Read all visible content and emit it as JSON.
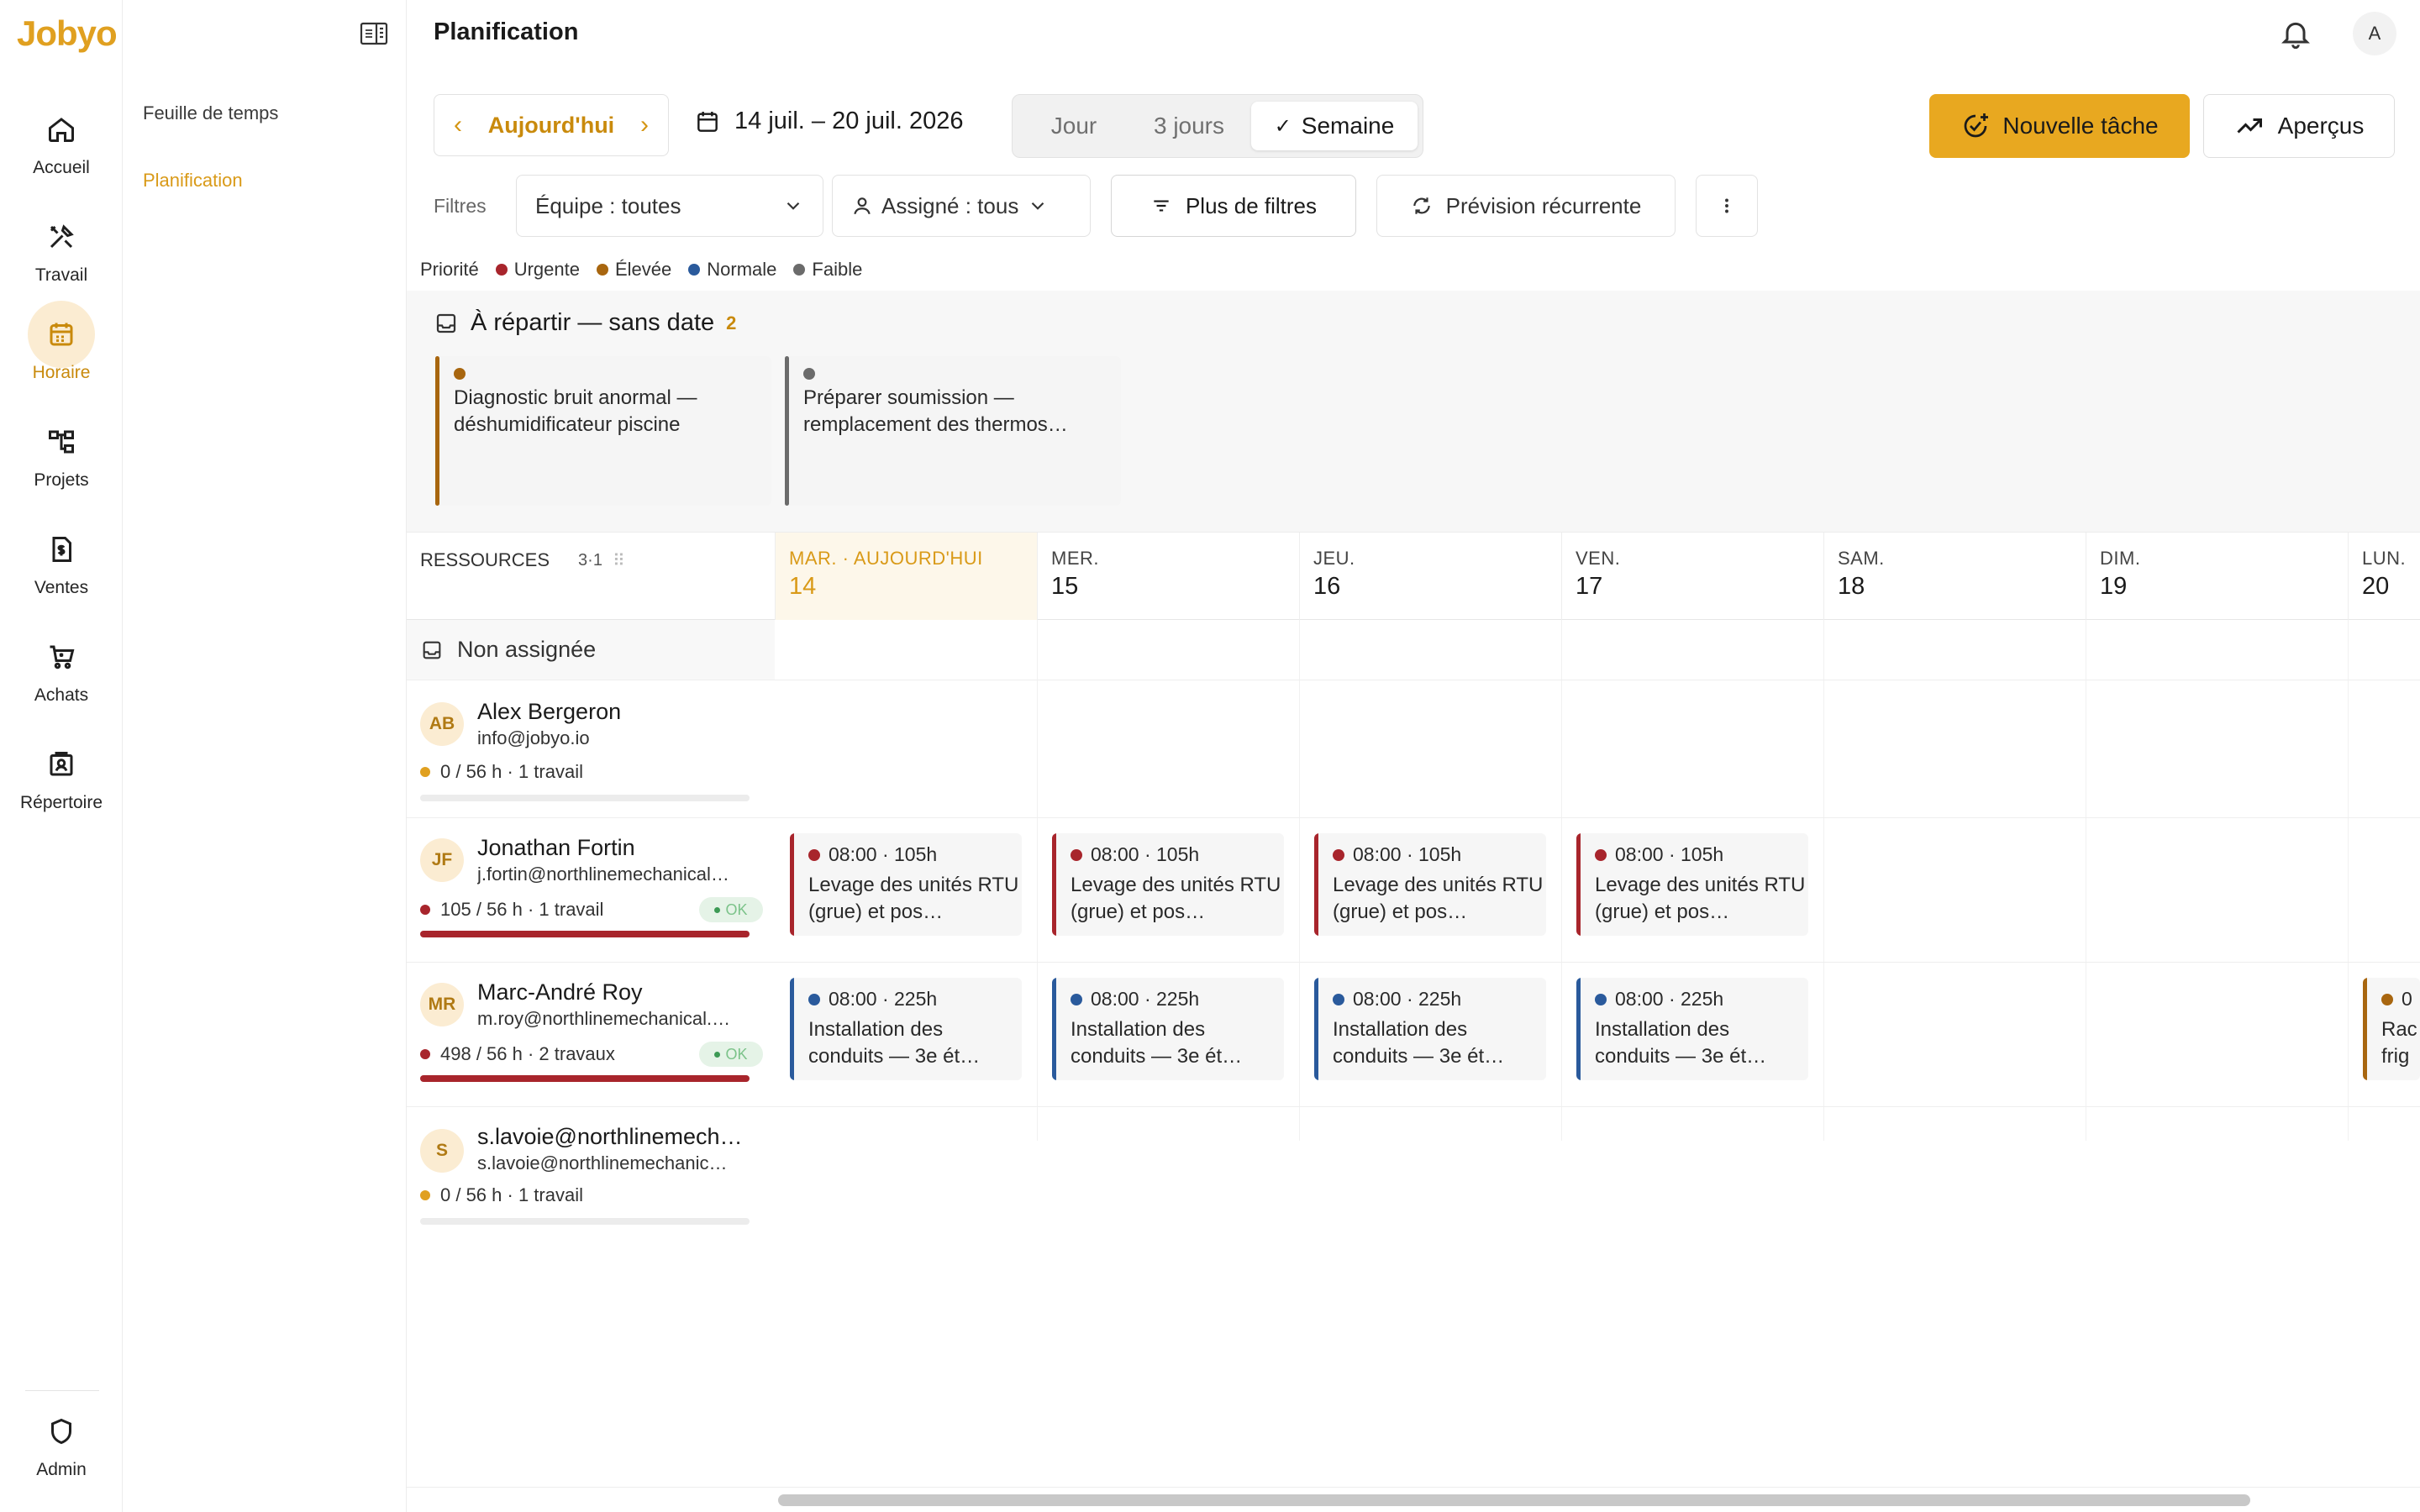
{
  "app": {
    "brand": "Jobyo",
    "user_initial": "A"
  },
  "rail": [
    {
      "label": "Accueil",
      "icon": "home-icon"
    },
    {
      "label": "Travail",
      "icon": "tools-icon"
    },
    {
      "label": "Horaire",
      "icon": "calendar-icon",
      "active": true
    },
    {
      "label": "Projets",
      "icon": "sitemap-icon"
    },
    {
      "label": "Ventes",
      "icon": "invoice-icon"
    },
    {
      "label": "Achats",
      "icon": "cart-icon"
    },
    {
      "label": "Répertoire",
      "icon": "contacts-icon"
    }
  ],
  "rail_bottom": {
    "label": "Admin",
    "icon": "shield-icon"
  },
  "subnav": [
    {
      "label": "Feuille de temps"
    },
    {
      "label": "Planification",
      "active": true
    }
  ],
  "header": {
    "title": "Planification"
  },
  "toolbar": {
    "today_label": "Aujourd'hui",
    "range_label": "14 juil. – 20 juil. 2026",
    "views": [
      "Jour",
      "3 jours",
      "Semaine"
    ],
    "active_view": "Semaine",
    "new_task_label": "Nouvelle tâche",
    "overview_label": "Aperçus"
  },
  "filters": {
    "label": "Filtres",
    "team": "Équipe : toutes",
    "assignee": "Assigné : tous",
    "more": "Plus de filtres",
    "recurring": "Prévision récurrente"
  },
  "priority": {
    "label": "Priorité",
    "items": [
      {
        "label": "Urgente",
        "color": "#a8252c"
      },
      {
        "label": "Élevée",
        "color": "#a8660f"
      },
      {
        "label": "Normale",
        "color": "#2a5a9c"
      },
      {
        "label": "Faible",
        "color": "#6b6b6b"
      }
    ]
  },
  "unassigned_strip": {
    "title": "À répartir — sans date",
    "count": "2",
    "cards": [
      {
        "text": "Diagnostic bruit anormal — déshumidificateur piscine",
        "color": "#a8660f"
      },
      {
        "text": "Préparer soumission — remplacement des thermos…",
        "color": "#6b6b6b"
      }
    ]
  },
  "grid": {
    "resources_label": "RESSOURCES",
    "resources_count": "3·1",
    "days": [
      {
        "name": "MAR. · AUJOURD'HUI",
        "num": "14",
        "today": true
      },
      {
        "name": "MER.",
        "num": "15"
      },
      {
        "name": "JEU.",
        "num": "16"
      },
      {
        "name": "VEN.",
        "num": "17"
      },
      {
        "name": "SAM.",
        "num": "18"
      },
      {
        "name": "DIM.",
        "num": "19"
      },
      {
        "name": "LUN.",
        "num": "20"
      }
    ],
    "unassigned_row_label": "Non assignée",
    "resources": [
      {
        "initials": "AB",
        "name": "Alex Bergeron",
        "email": "info@jobyo.io",
        "load": "0 / 56 h · 1 travail",
        "dot": "#e0a020",
        "overloaded": false,
        "badge": "",
        "load_fraction": 0
      },
      {
        "initials": "JF",
        "name": "Jonathan Fortin",
        "email": "j.fortin@northlinemechanical…",
        "load": "105 / 56 h · 1 travail",
        "dot": "#a8252c",
        "overloaded": true,
        "badge": "OK",
        "load_fraction": 1.88
      },
      {
        "initials": "MR",
        "name": "Marc-André Roy",
        "email": "m.roy@northlinemechanical.…",
        "load": "498 / 56 h · 2 travaux",
        "dot": "#a8252c",
        "overloaded": true,
        "badge": "OK",
        "load_fraction": 8.89
      },
      {
        "initials": "S",
        "name": "s.lavoie@northlinemech…",
        "email": "s.lavoie@northlinemechanic…",
        "load": "0 / 56 h · 1 travail",
        "dot": "#e0a020",
        "overloaded": false,
        "badge": "",
        "load_fraction": 0
      }
    ],
    "tasks_fortin": [
      {
        "time": "08:00 · 105h",
        "title": "Levage des unités RTU (grue) et pos…",
        "color": "#a8252c"
      },
      {
        "time": "08:00 · 105h",
        "title": "Levage des unités RTU (grue) et pos…",
        "color": "#a8252c"
      },
      {
        "time": "08:00 · 105h",
        "title": "Levage des unités RTU (grue) et pos…",
        "color": "#a8252c"
      },
      {
        "time": "08:00 · 105h",
        "title": "Levage des unités RTU (grue) et pos…",
        "color": "#a8252c"
      }
    ],
    "tasks_roy": [
      {
        "time": "08:00 · 225h",
        "title": "Installation des conduits — 3e ét…",
        "color": "#2a5a9c"
      },
      {
        "time": "08:00 · 225h",
        "title": "Installation des conduits — 3e ét…",
        "color": "#2a5a9c"
      },
      {
        "time": "08:00 · 225h",
        "title": "Installation des conduits — 3e ét…",
        "color": "#2a5a9c"
      },
      {
        "time": "08:00 · 225h",
        "title": "Installation des conduits — 3e ét…",
        "color": "#2a5a9c"
      },
      {
        "time": "0",
        "title": "Rac frig",
        "color": "#a8660f"
      }
    ]
  }
}
